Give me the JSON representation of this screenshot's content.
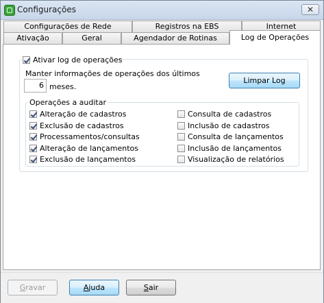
{
  "window": {
    "title": "Configurações",
    "close_glyph": "✕"
  },
  "tabs": {
    "row_back": [
      "Configurações de Rede",
      "Registros na EBS",
      "Internet"
    ],
    "row_front": [
      "Ativação",
      "Geral",
      "Agendador de Rotinas",
      "Log de Operações"
    ],
    "active": "Log de Operações"
  },
  "log": {
    "enable_label": "Ativar log de operações",
    "enable_checked": true,
    "keep_info_label": "Manter informações de operações dos últimos",
    "days_value": "6",
    "days_unit": "meses.",
    "clear_button": "Limpar Log"
  },
  "audit": {
    "group_title": "Operações a auditar",
    "left": [
      {
        "label": "Alteração de cadastros",
        "checked": true
      },
      {
        "label": "Exclusão de cadastros",
        "checked": true
      },
      {
        "label": "Processamentos/consultas",
        "checked": true
      },
      {
        "label": "Alteração de lançamentos",
        "checked": true
      },
      {
        "label": "Exclusão de lançamentos",
        "checked": true
      }
    ],
    "right": [
      {
        "label": "Consulta de cadastros",
        "checked": false
      },
      {
        "label": "Inclusão de cadastros",
        "checked": false
      },
      {
        "label": "Consulta de lançamentos",
        "checked": false
      },
      {
        "label": "Inclusão de lançamentos",
        "checked": false
      },
      {
        "label": "Visualização de relatórios",
        "checked": false
      }
    ]
  },
  "footer": {
    "save_key": "G",
    "save_rest": "ravar",
    "help_key": "A",
    "help_rest": "juda",
    "exit_key": "S",
    "exit_rest": "air"
  }
}
